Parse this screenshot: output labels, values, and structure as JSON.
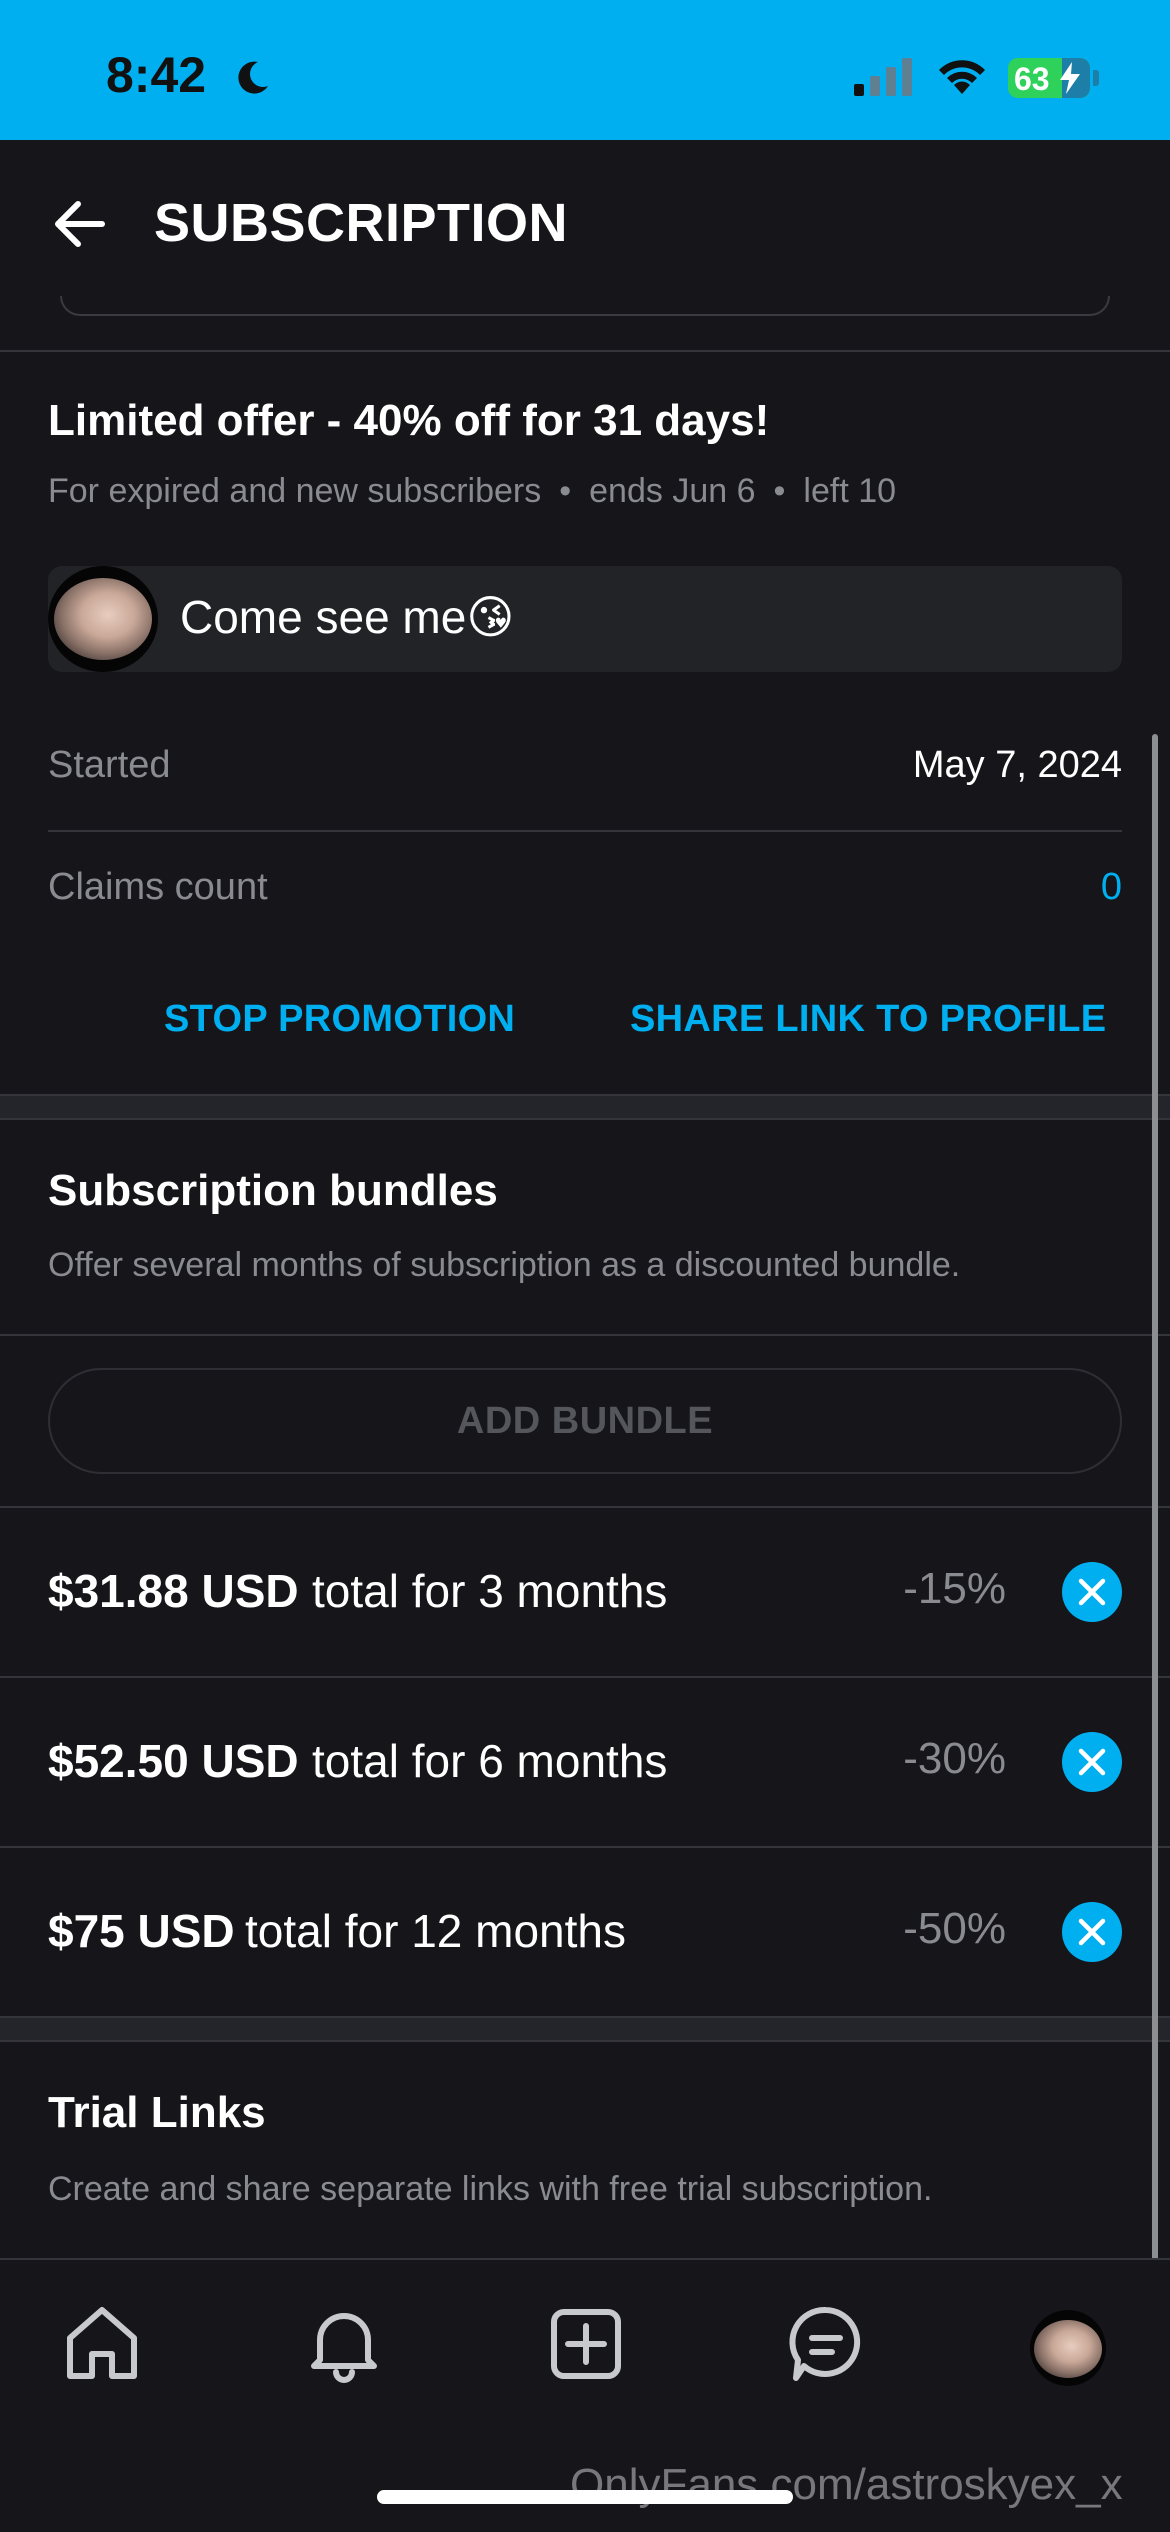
{
  "status_bar": {
    "time": "8:42",
    "battery_level": "63",
    "icons": [
      "moon-icon",
      "cellular-signal-icon",
      "wifi-icon",
      "battery-charging-icon"
    ]
  },
  "header": {
    "title": "SUBSCRIPTION",
    "back_icon": "arrow-left-icon"
  },
  "promotion": {
    "title": "Limited offer - 40% off for 31 days!",
    "audience": "For expired and new subscribers",
    "ends": "ends Jun 6",
    "left": "left 10",
    "separator": "•",
    "message": "Come see me😘",
    "started_label": "Started",
    "started_value": "May 7, 2024",
    "claims_label": "Claims count",
    "claims_value": "0",
    "stop_label": "STOP PROMOTION",
    "share_label": "SHARE LINK TO PROFILE"
  },
  "bundles": {
    "title": "Subscription bundles",
    "description": "Offer several months of subscription as a discounted bundle.",
    "add_label": "ADD BUNDLE",
    "items": [
      {
        "price": "$31.88 USD",
        "period": "total for 3 months",
        "discount": "-15%"
      },
      {
        "price": "$52.50 USD",
        "period": "total for 6 months",
        "discount": "-30%"
      },
      {
        "price": "$75 USD",
        "period": "total for 12 months",
        "discount": "-50%"
      }
    ]
  },
  "trial_links": {
    "title": "Trial Links",
    "description": "Create and share separate links with free trial subscription."
  },
  "bottom_nav": {
    "items": [
      "home-icon",
      "bell-icon",
      "add-post-icon",
      "messages-icon",
      "profile-avatar"
    ]
  },
  "watermark": "OnlyFans.com/astroskyex_x",
  "colors": {
    "accent": "#00aff0",
    "background": "#16161a",
    "muted_text": "#8a8b90"
  }
}
